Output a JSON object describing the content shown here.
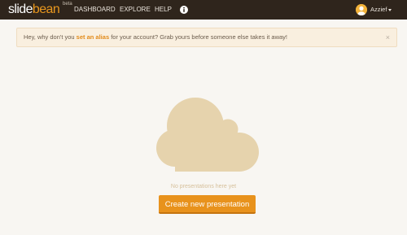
{
  "brand": {
    "logo_part1": "slide",
    "logo_part2": "bean",
    "beta_tag": "beta"
  },
  "nav": {
    "items": [
      {
        "label": "DASHBOARD"
      },
      {
        "label": "EXPLORE"
      },
      {
        "label": "HELP"
      }
    ],
    "info_icon": "info-circle-icon"
  },
  "user": {
    "name": "Azzief",
    "avatar_icon": "user-avatar-icon",
    "caret_icon": "caret-down-icon"
  },
  "alert": {
    "text_before": "Hey, why don't you ",
    "link_text": "set an alias",
    "text_after": " for your account? Grab yours before someone else takes it away!",
    "close_symbol": "×"
  },
  "empty_state": {
    "illustration_icon": "cloud-icon",
    "message": "No presentations here yet",
    "button_label": "Create new presentation"
  },
  "colors": {
    "nav_background": "#2f251c",
    "brand_orange": "#e8921c",
    "alert_background": "#f9efdf",
    "cloud": "#e6d3ad",
    "page_background": "#f8f6f2"
  }
}
